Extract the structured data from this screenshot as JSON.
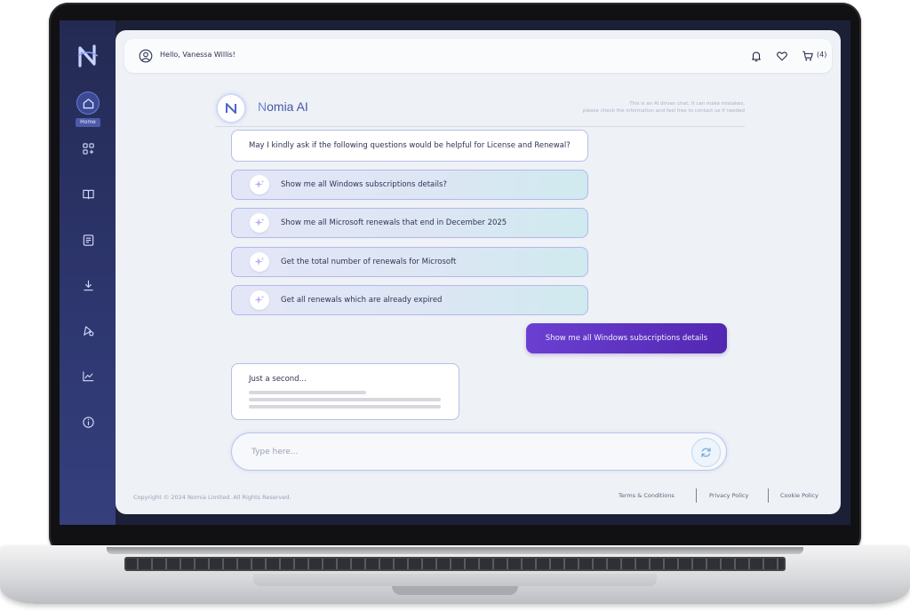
{
  "header": {
    "greeting": "Hello, Vanessa Willis!",
    "cart_count": "(4)"
  },
  "sidebar": {
    "items": [
      {
        "icon": "home-icon",
        "label": "Home",
        "active": true
      },
      {
        "icon": "apps-icon"
      },
      {
        "icon": "book-icon"
      },
      {
        "icon": "document-list-icon"
      },
      {
        "icon": "download-icon"
      },
      {
        "icon": "shapes-icon"
      },
      {
        "icon": "chart-line-icon"
      },
      {
        "icon": "info-icon"
      }
    ]
  },
  "chat": {
    "bot_name": "Nomia AI",
    "bot_name_first": "N",
    "bot_name_rest": "omia AI",
    "disclaimer_line1": "This is an AI driven chat, it can make mistakes,",
    "disclaimer_line2": "please check the information and feel free to contact us if needed",
    "question": "May I kindly ask if the following questions would be helpful for License and Renewal?",
    "suggestions": [
      "Show me all Windows subscriptions details?",
      "Show me all Microsoft renewals that end in December 2025",
      "Get the total number of renewals for Microsoft",
      "Get all renewals which are already expired"
    ],
    "user_message": "Show me all Windows subscriptions details",
    "bot_reply": "Just a second...",
    "input_placeholder": "Type here..."
  },
  "footer": {
    "copyright": "Copyright © 2024 Nomia Limited. All Rights Reserved.",
    "links": [
      "Terms & Conditions",
      "Privacy Policy",
      "Cookie Policy"
    ]
  },
  "colors": {
    "sidebar": "#2e3770",
    "accent_purple": "#5a2dbd",
    "app_background": "#eef1f6"
  }
}
